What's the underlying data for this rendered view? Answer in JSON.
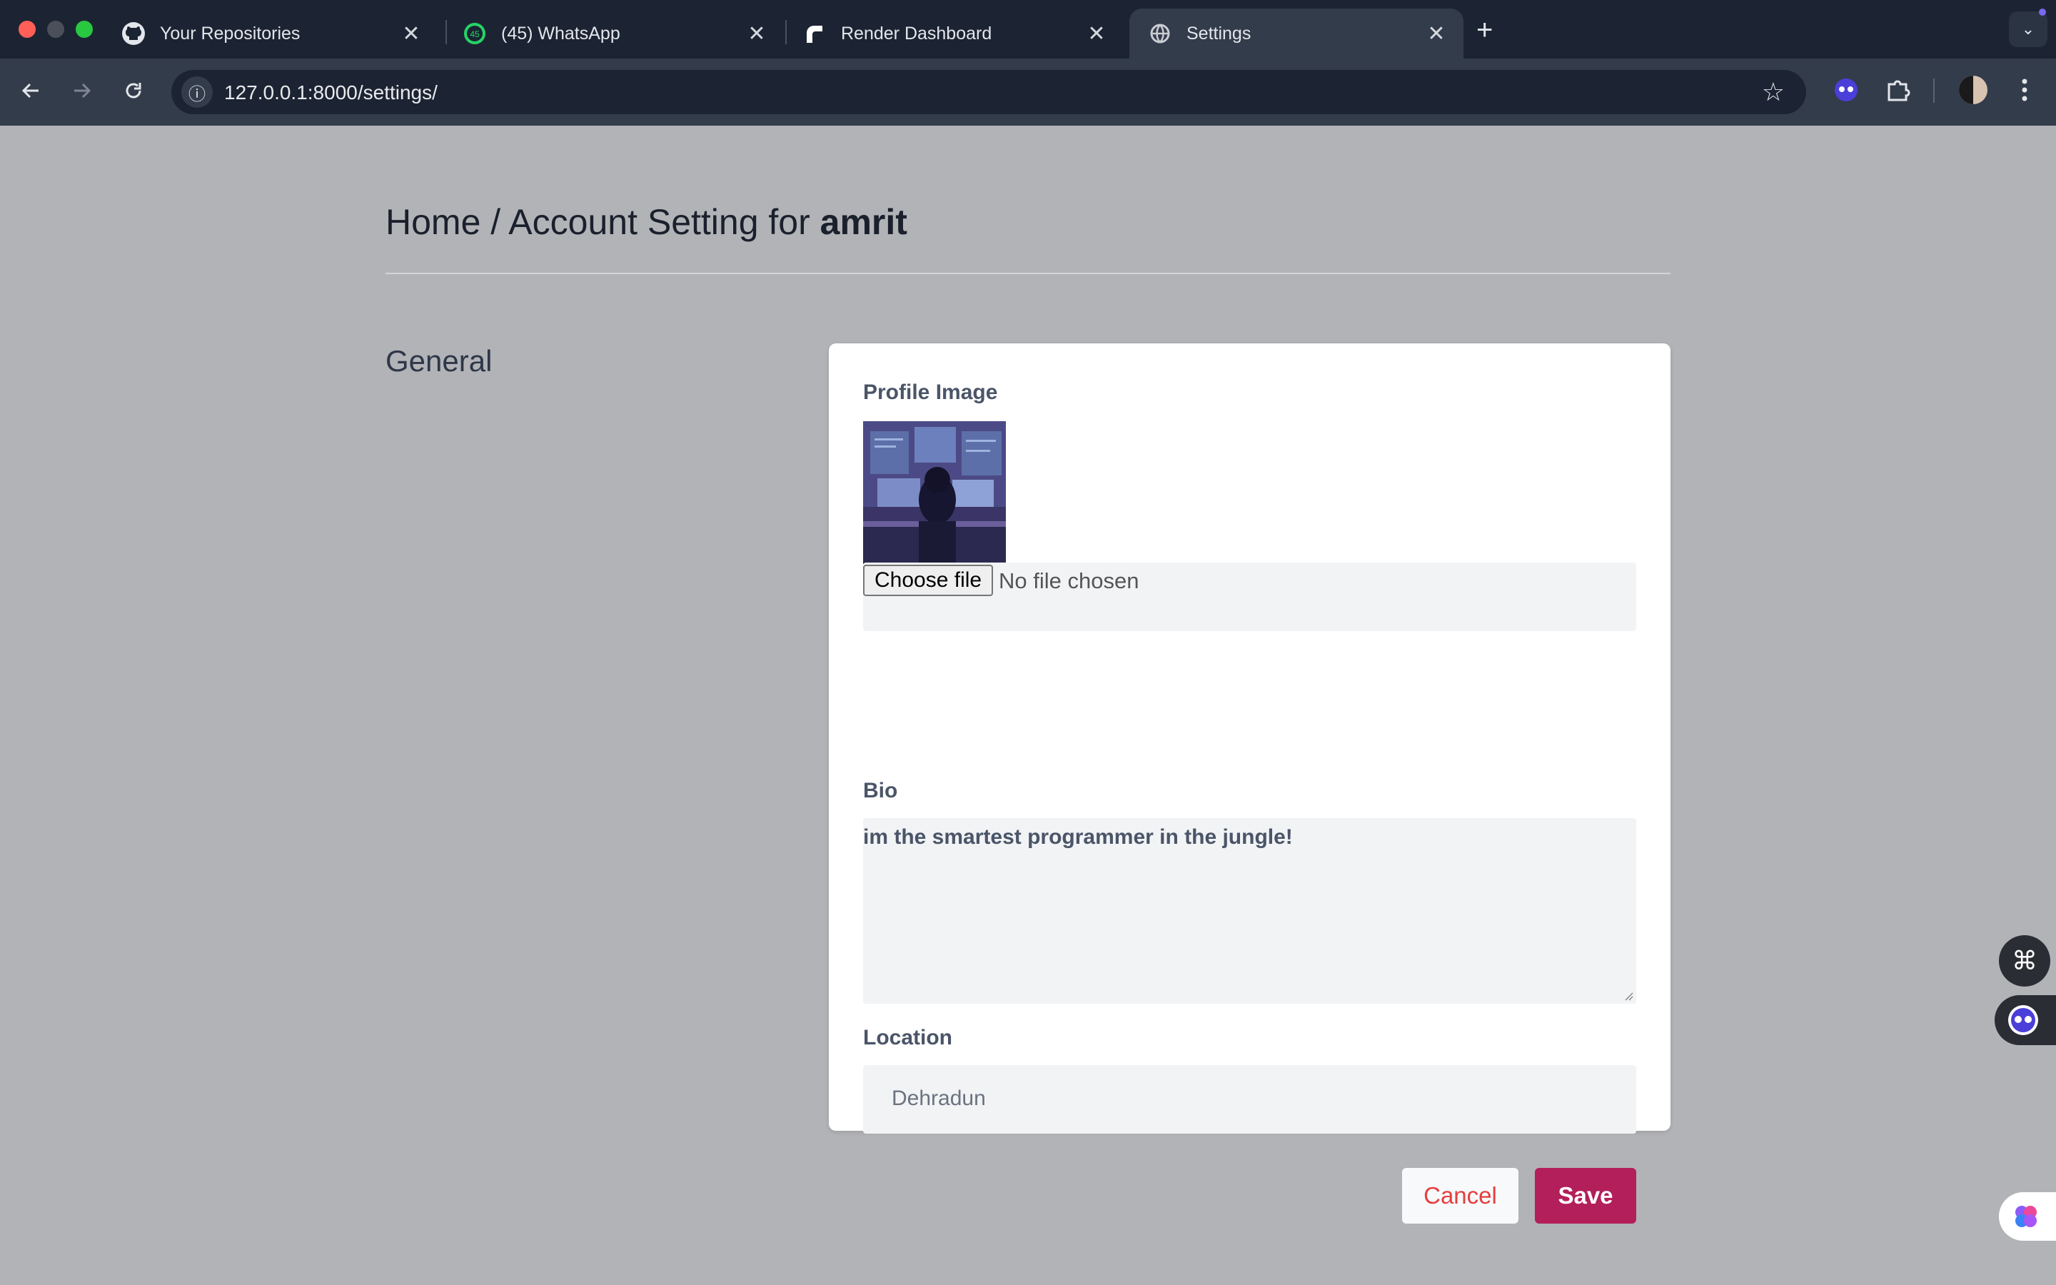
{
  "browser": {
    "tabs": [
      {
        "title": "Your Repositories",
        "icon": "github-icon"
      },
      {
        "title": "(45) WhatsApp",
        "icon": "whatsapp-icon",
        "badge": "45"
      },
      {
        "title": "Render Dashboard",
        "icon": "render-icon"
      },
      {
        "title": "Settings",
        "icon": "globe-icon",
        "active": true
      }
    ],
    "new_tab": "+",
    "close_glyph": "✕",
    "url": "127.0.0.1:8000/settings/"
  },
  "page": {
    "breadcrumb_prefix": "Home / Account Setting for ",
    "username": "amrit",
    "section_title": "General"
  },
  "form": {
    "profile_image_label": "Profile Image",
    "file_button_label": "Choose file",
    "file_status": "No file chosen",
    "bio_label": "Bio",
    "bio_value": "im the smartest programmer in the jungle!",
    "location_label": "Location",
    "location_value": "Dehradun",
    "cancel_label": "Cancel",
    "save_label": "Save"
  },
  "colors": {
    "page_bg": "#b2b3b7",
    "save_button": "#b21f5a",
    "cancel_text": "#e53e3e",
    "tabbar_bg": "#1c2433",
    "toolbar_bg": "#333c4b"
  }
}
